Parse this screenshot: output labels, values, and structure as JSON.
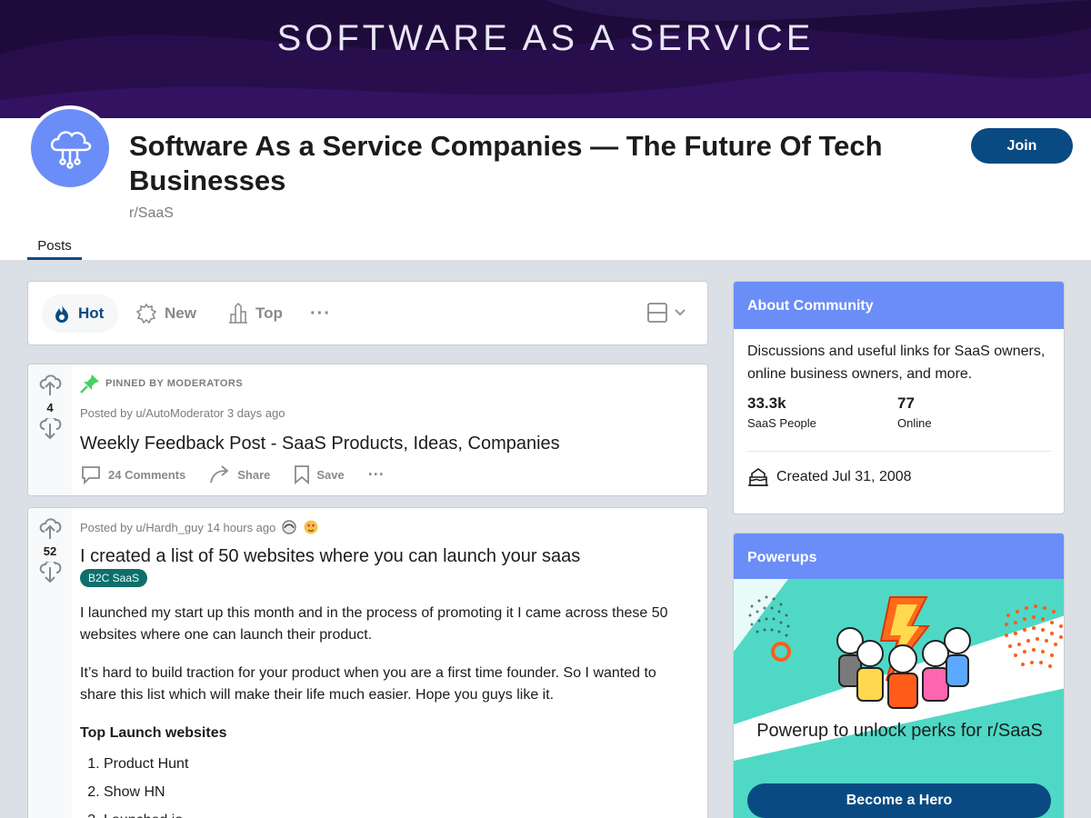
{
  "banner": {
    "text": "SOFTWARE AS A SERVICE"
  },
  "community": {
    "title": "Software As a Service Companies — The Future Of Tech Businesses",
    "name": "r/SaaS",
    "join_label": "Join",
    "tab_posts": "Posts"
  },
  "sort": {
    "hot": "Hot",
    "new": "New",
    "top": "Top",
    "more": "···"
  },
  "posts": [
    {
      "pinned_label": "PINNED BY MODERATORS",
      "votes": "4",
      "meta": "Posted by u/AutoModerator 3 days ago",
      "title": "Weekly Feedback Post - SaaS Products, Ideas, Companies",
      "comments": "24 Comments",
      "share": "Share",
      "save": "Save",
      "more": "···"
    },
    {
      "votes": "52",
      "meta": "Posted by u/Hardh_guy 14 hours ago",
      "title": "I created a list of 50 websites where you can launch your saas",
      "flair": "B2C SaaS",
      "paragraphs": [
        "I launched my start up this month and in the process of promoting it I came across these 50 websites where one can launch their product.",
        "It’s hard to build traction for your product when you are a first time founder. So I wanted to share this list which will make their life much easier. Hope you guys like it."
      ],
      "list_heading": "Top Launch websites",
      "list": [
        "Product Hunt",
        "Show HN",
        "Launched.io"
      ]
    }
  ],
  "about": {
    "heading": "About Community",
    "description": "Discussions and useful links for SaaS owners, online business owners, and more.",
    "members_count": "33.3k",
    "members_label": "SaaS People",
    "online_count": "77",
    "online_label": "Online",
    "created": "Created Jul 31, 2008"
  },
  "powerups": {
    "heading": "Powerups",
    "text": "Powerup to unlock perks for r/SaaS",
    "button": "Become a Hero"
  },
  "colors": {
    "brand_blue": "#0a4a82",
    "card_header": "#6b8df7",
    "flair_bg": "#0f6e6a",
    "banner_bg": "#1e0b3b"
  }
}
